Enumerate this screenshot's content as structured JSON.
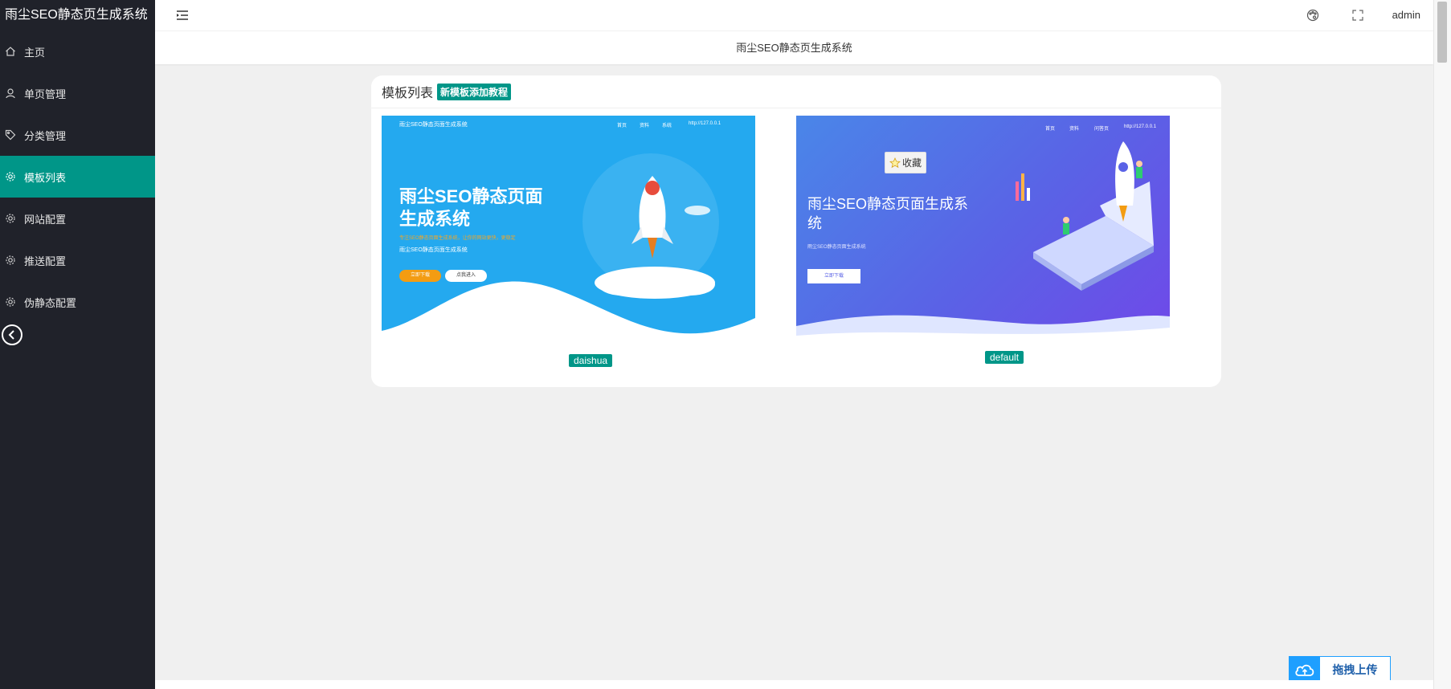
{
  "app": {
    "title": "雨尘SEO静态页生成系统"
  },
  "sidebar": {
    "items": [
      {
        "label": "主页",
        "icon": "home-icon",
        "active": false
      },
      {
        "label": "单页管理",
        "icon": "user-icon",
        "active": false
      },
      {
        "label": "分类管理",
        "icon": "tag-icon",
        "active": false
      },
      {
        "label": "模板列表",
        "icon": "gear-icon",
        "active": true
      },
      {
        "label": "网站配置",
        "icon": "gear-icon",
        "active": false
      },
      {
        "label": "推送配置",
        "icon": "gear-icon",
        "active": false
      },
      {
        "label": "伪静态配置",
        "icon": "gear-icon",
        "active": false
      }
    ],
    "collapse_icon": "chevron-left-icon"
  },
  "header": {
    "menu_icon": "menu-fold-icon",
    "theme_icon": "palette-icon",
    "fullscreen_icon": "fullscreen-icon",
    "user": "admin"
  },
  "subheader": {
    "title": "雨尘SEO静态页生成系统"
  },
  "panel": {
    "title": "模板列表",
    "tutorial_label": "新模板添加教程",
    "templates": [
      {
        "name": "daishua",
        "preview": {
          "nav_brand": "雨尘SEO静态页面生成系统",
          "nav_links": [
            "首页",
            "资料",
            "系统",
            "http://127.0.0.1"
          ],
          "headline_line1": "雨尘SEO静态页面",
          "headline_line2": "生成系统",
          "tagline": "专注SEO静态页面生成系统，让你的网站更快，更稳定",
          "subtitle": "雨尘SEO静态页面生成系统",
          "btn_primary": "立即下载",
          "btn_secondary": "点我进入"
        }
      },
      {
        "name": "default",
        "preview": {
          "nav_links": [
            "首页",
            "资料",
            "问答页",
            "http://127.0.0.1"
          ],
          "headline_line1": "雨尘SEO静态页面生成系",
          "headline_line2": "统",
          "subtitle": "雨尘SEO静态页面生成系统",
          "btn_primary": "立即下载"
        }
      }
    ]
  },
  "favorite": {
    "label": "收藏",
    "icon": "star-icon"
  },
  "upload": {
    "label": "拖拽上传",
    "icon": "cloud-upload-icon"
  },
  "colors": {
    "sidebar_bg": "#20222a",
    "accent": "#009688",
    "upload_blue": "#1e9fff"
  }
}
